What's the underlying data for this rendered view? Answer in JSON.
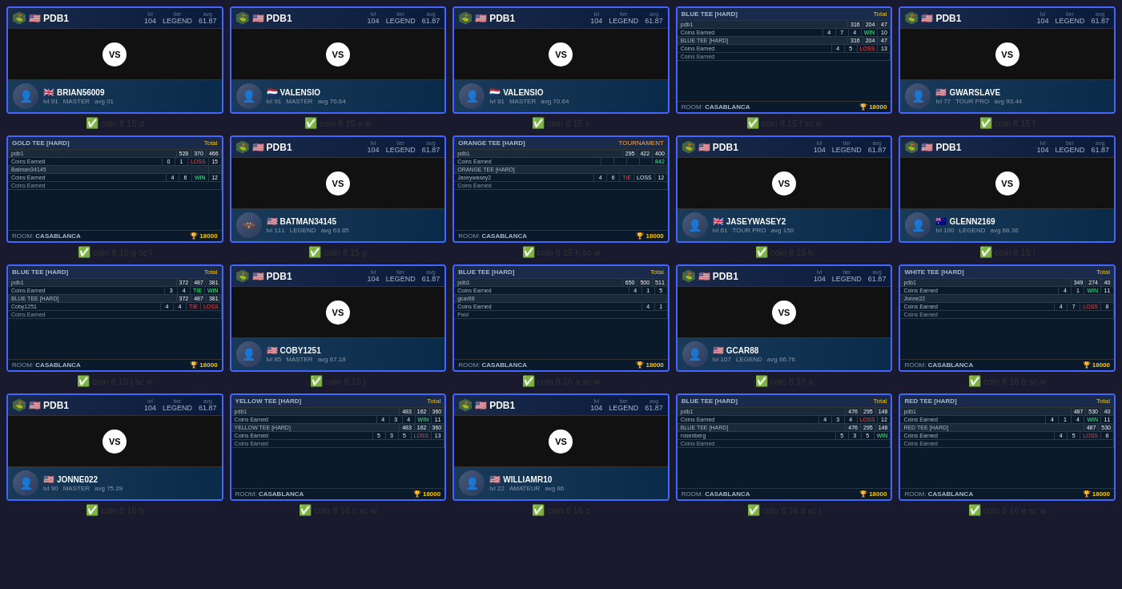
{
  "cards": [
    {
      "id": "card-1",
      "type": "vs",
      "top_player": "PDB1",
      "top_flag": "🇺🇸",
      "top_lvl": "104",
      "top_tier": "LEGEND",
      "top_avg": "61.87",
      "bottom_player": "BRIAN56009",
      "bottom_flag": "🇬🇧",
      "bottom_lvl": "91",
      "bottom_tier": "MASTER",
      "bottom_avg": "01",
      "label": "coin 8 15 d"
    },
    {
      "id": "card-2",
      "type": "vs",
      "top_player": "PDB1",
      "top_flag": "🇺🇸",
      "top_lvl": "104",
      "top_tier": "LEGEND",
      "top_avg": "61.87",
      "bottom_player": "VALENSIO",
      "bottom_flag": "🇳🇱",
      "bottom_lvl": "91",
      "bottom_tier": "MASTER",
      "bottom_avg": "70.64",
      "label": "coin 8 15 e w"
    },
    {
      "id": "card-3",
      "type": "vs",
      "top_player": "PDB1",
      "top_flag": "🇺🇸",
      "top_lvl": "104",
      "top_tier": "LEGEND",
      "top_avg": "61.87",
      "bottom_player": "VALENSIO",
      "bottom_flag": "🇳🇱",
      "bottom_lvl": "91",
      "bottom_tier": "MASTER",
      "bottom_avg": "70.64",
      "label": "coin 8 15 e"
    },
    {
      "id": "card-4",
      "type": "scorecard",
      "room": "CASABLANCA",
      "prize": "🏆 18000",
      "label": "coin 8 15 f sc w"
    },
    {
      "id": "card-5",
      "type": "vs",
      "top_player": "PDB1",
      "top_flag": "🇺🇸",
      "top_lvl": "104",
      "top_tier": "LEGEND",
      "top_avg": "61.87",
      "bottom_player": "GWARSLAVE",
      "bottom_flag": "🇺🇸",
      "bottom_lvl": "77",
      "bottom_tier": "TOUR PRO",
      "bottom_avg": "93.44",
      "label": "coin 8 15 f"
    },
    {
      "id": "card-6",
      "type": "scorecard",
      "room": "CASABLANCA",
      "prize": "🏆 18000",
      "label": "coin 8 15 g sc l"
    },
    {
      "id": "card-7",
      "type": "vs",
      "top_player": "PDB1",
      "top_flag": "🇺🇸",
      "top_lvl": "104",
      "top_tier": "LEGEND",
      "top_avg": "61.87",
      "bottom_player": "BATMAN34145",
      "bottom_flag": "🇺🇸",
      "bottom_lvl": "111",
      "bottom_tier": "LEGEND",
      "bottom_avg": "63.85",
      "label": "coin 8 15 g"
    },
    {
      "id": "card-8",
      "type": "scorecard",
      "room": "CASABLANCA",
      "prize": "🏆 18000",
      "label": "coin 8 15 h sc w"
    },
    {
      "id": "card-9",
      "type": "vs",
      "top_player": "PDB1",
      "top_flag": "🇺🇸",
      "top_lvl": "104",
      "top_tier": "LEGEND",
      "top_avg": "61.87",
      "bottom_player": "JASEYWASEY2",
      "bottom_flag": "🇬🇧",
      "bottom_lvl": "61",
      "bottom_tier": "TOUR PRO",
      "bottom_avg": "150",
      "label": "coin 8 15 h"
    },
    {
      "id": "card-10",
      "type": "vs",
      "top_player": "PDB1",
      "top_flag": "🇺🇸",
      "top_lvl": "104",
      "top_tier": "LEGEND",
      "top_avg": "61.87",
      "bottom_player": "GLENN2169",
      "bottom_flag": "🇦🇺",
      "bottom_lvl": "100",
      "bottom_tier": "LEGEND",
      "bottom_avg": "68.36",
      "label": "coin 8 15 i"
    },
    {
      "id": "card-11",
      "type": "scorecard",
      "room": "CASABLANCA",
      "prize": "🏆 18000",
      "label": "coin 8 15 j sc w"
    },
    {
      "id": "card-12",
      "type": "vs",
      "top_player": "PDB1",
      "top_flag": "🇺🇸",
      "top_lvl": "104",
      "top_tier": "LEGEND",
      "top_avg": "61.87",
      "bottom_player": "COBY1251",
      "bottom_flag": "🇺🇸",
      "bottom_lvl": "85",
      "bottom_tier": "MASTER",
      "bottom_avg": "67.18",
      "label": "coin 8 15 j"
    },
    {
      "id": "card-13",
      "type": "scorecard",
      "room": "CASABLANCA",
      "prize": "🏆 18000",
      "label": "coin 8 16 a sc w"
    },
    {
      "id": "card-14",
      "type": "vs",
      "top_player": "PDB1",
      "top_flag": "🇺🇸",
      "top_lvl": "104",
      "top_tier": "LEGEND",
      "top_avg": "61.87",
      "bottom_player": "GCAR88",
      "bottom_flag": "🇺🇸",
      "bottom_lvl": "107",
      "bottom_tier": "LEGEND",
      "bottom_avg": "66.76",
      "label": "coin 8 16 a"
    },
    {
      "id": "card-15",
      "type": "scorecard",
      "room": "CASABLANCA",
      "prize": "🏆 18000",
      "label": "coin 8 16 b sc w"
    },
    {
      "id": "card-16",
      "type": "vs",
      "top_player": "PDB1",
      "top_flag": "🇺🇸",
      "top_lvl": "104",
      "top_tier": "LEGEND",
      "top_avg": "61.87",
      "bottom_player": "JONNE022",
      "bottom_flag": "🇺🇸",
      "bottom_lvl": "90",
      "bottom_tier": "MASTER",
      "bottom_avg": "75.28",
      "label": "coin 8 16 b"
    },
    {
      "id": "card-17",
      "type": "scorecard",
      "room": "CASABLANCA",
      "prize": "🏆 18000",
      "label": "coin 8 16 c sc w"
    },
    {
      "id": "card-18",
      "type": "vs",
      "top_player": "PDB1",
      "top_flag": "🇺🇸",
      "top_lvl": "104",
      "top_tier": "LEGEND",
      "top_avg": "61.87",
      "bottom_player": "WILLIAMR10",
      "bottom_flag": "🇺🇸",
      "bottom_lvl": "22",
      "bottom_tier": "AMATEUR",
      "bottom_avg": "86",
      "label": "coin 8 16 c"
    },
    {
      "id": "card-19",
      "type": "scorecard",
      "room": "CASABLANCA",
      "prize": "🏆 18000",
      "label": "coin 8 16 d sc l"
    },
    {
      "id": "card-20",
      "type": "scorecard",
      "room": "CASABLANCA",
      "prize": "🏆 18000",
      "label": "coin 8 16 e sc w"
    }
  ],
  "colors": {
    "accent": "#4466ff",
    "positive": "#44bb44",
    "negative": "#ff4444",
    "warning": "#ffaa44",
    "gold": "#ffcc00"
  }
}
